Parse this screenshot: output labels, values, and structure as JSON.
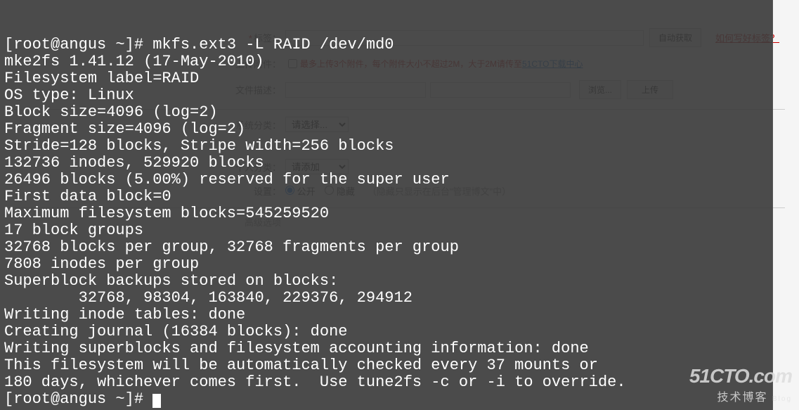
{
  "form": {
    "tags_label": "标签：",
    "auto_get_btn": "自动获取",
    "tags_help_link": "如何写好标签？",
    "upload_label": "上传附件：",
    "upload_hint_prefix": "最多上传3个附件，每个附件大小不超过2M，大于2M请传至",
    "upload_hint_link": "51CTO下载中心",
    "file_desc_label": "文件描述：",
    "browse_btn": "浏览...",
    "upload_btn": "上传",
    "sys_category_label": "系统分类：",
    "sys_category_value": "请选择...",
    "personal_cat_label": "个人分类：",
    "personal_cat_opt": "请添加",
    "settings_label": "设置：",
    "radio_public": "公开",
    "radio_hidden": "隐藏",
    "settings_hint": "（隐藏只显示在后台\"管理博文\"中）",
    "adv_label": "高级选项"
  },
  "terminal": {
    "lines": [
      "[root@angus ~]# mkfs.ext3 -L RAID /dev/md0",
      "mke2fs 1.41.12 (17-May-2010)",
      "Filesystem label=RAID",
      "OS type: Linux",
      "Block size=4096 (log=2)",
      "Fragment size=4096 (log=2)",
      "Stride=128 blocks, Stripe width=256 blocks",
      "132736 inodes, 529920 blocks",
      "26496 blocks (5.00%) reserved for the super user",
      "First data block=0",
      "Maximum filesystem blocks=545259520",
      "17 block groups",
      "32768 blocks per group, 32768 fragments per group",
      "7808 inodes per group",
      "Superblock backups stored on blocks: ",
      "        32768, 98304, 163840, 229376, 294912",
      "",
      "Writing inode tables: done                            ",
      "Creating journal (16384 blocks): done",
      "Writing superblocks and filesystem accounting information: done",
      "",
      "This filesystem will be automatically checked every 37 mounts or",
      "180 days, whichever comes first.  Use tune2fs -c or -i to override."
    ],
    "prompt": "[root@angus ~]# "
  },
  "watermark": {
    "top": "51CTO.com",
    "bottom": "技术博客",
    "small": "Blog"
  }
}
